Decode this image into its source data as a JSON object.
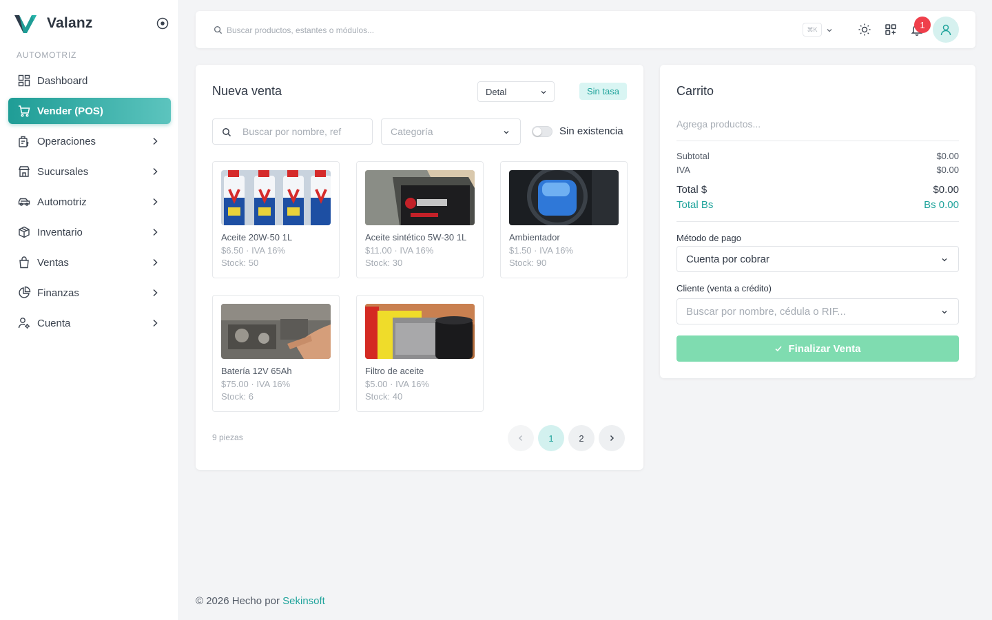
{
  "brand": {
    "name": "Valanz"
  },
  "sidebar": {
    "section": "AUTOMOTRIZ",
    "items": [
      {
        "label": "Dashboard",
        "icon": "dashboard-icon",
        "active": false,
        "has_children": false
      },
      {
        "label": "Vender (POS)",
        "icon": "cart-icon",
        "active": true,
        "has_children": false
      },
      {
        "label": "Operaciones",
        "icon": "operations-icon",
        "active": false,
        "has_children": true
      },
      {
        "label": "Sucursales",
        "icon": "store-icon",
        "active": false,
        "has_children": true
      },
      {
        "label": "Automotriz",
        "icon": "car-icon",
        "active": false,
        "has_children": true
      },
      {
        "label": "Inventario",
        "icon": "box-icon",
        "active": false,
        "has_children": true
      },
      {
        "label": "Ventas",
        "icon": "bag-icon",
        "active": false,
        "has_children": true
      },
      {
        "label": "Finanzas",
        "icon": "pie-chart-icon",
        "active": false,
        "has_children": true
      },
      {
        "label": "Cuenta",
        "icon": "user-settings-icon",
        "active": false,
        "has_children": true
      }
    ]
  },
  "topbar": {
    "search_placeholder": "Buscar productos, estantes o módulos...",
    "shortcut": "⌘K",
    "notifications_count": "1"
  },
  "sale": {
    "title": "Nueva venta",
    "price_type": "Detal",
    "rate_badge": "Sin tasa",
    "search_placeholder": "Buscar por nombre, ref",
    "category_placeholder": "Categoría",
    "stock_toggle_label": "Sin existencia",
    "products": [
      {
        "name": "Aceite 20W-50 1L",
        "price": "$6.50 · IVA 16%",
        "stock": "Stock: 50"
      },
      {
        "name": "Aceite sintético 5W-30 1L",
        "price": "$11.00 · IVA 16%",
        "stock": "Stock: 30"
      },
      {
        "name": "Ambientador",
        "price": "$1.50 · IVA 16%",
        "stock": "Stock: 90"
      },
      {
        "name": "Batería 12V 65Ah",
        "price": "$75.00 · IVA 16%",
        "stock": "Stock: 6"
      },
      {
        "name": "Filtro de aceite",
        "price": "$5.00 · IVA 16%",
        "stock": "Stock: 40"
      }
    ],
    "pieces": "9 piezas",
    "pages": [
      "1",
      "2"
    ],
    "current_page": "1"
  },
  "cart": {
    "title": "Carrito",
    "empty_text": "Agrega productos...",
    "subtotal_label": "Subtotal",
    "subtotal_value": "$0.00",
    "iva_label": "IVA",
    "iva_value": "$0.00",
    "total_usd_label": "Total $",
    "total_usd_value": "$0.00",
    "total_bs_label": "Total Bs",
    "total_bs_value": "Bs 0.00",
    "payment_label": "Método de pago",
    "payment_value": "Cuenta por cobrar",
    "client_label": "Cliente (venta a crédito)",
    "client_placeholder": "Buscar por nombre, cédula o RIF...",
    "finish_label": "Finalizar Venta"
  },
  "footer": {
    "text": "© 2026 Hecho por",
    "link": "Sekinsoft"
  },
  "colors": {
    "accent": "#1fa39b",
    "success_button": "#7fdcb0",
    "badge": "#ef3f4b"
  }
}
